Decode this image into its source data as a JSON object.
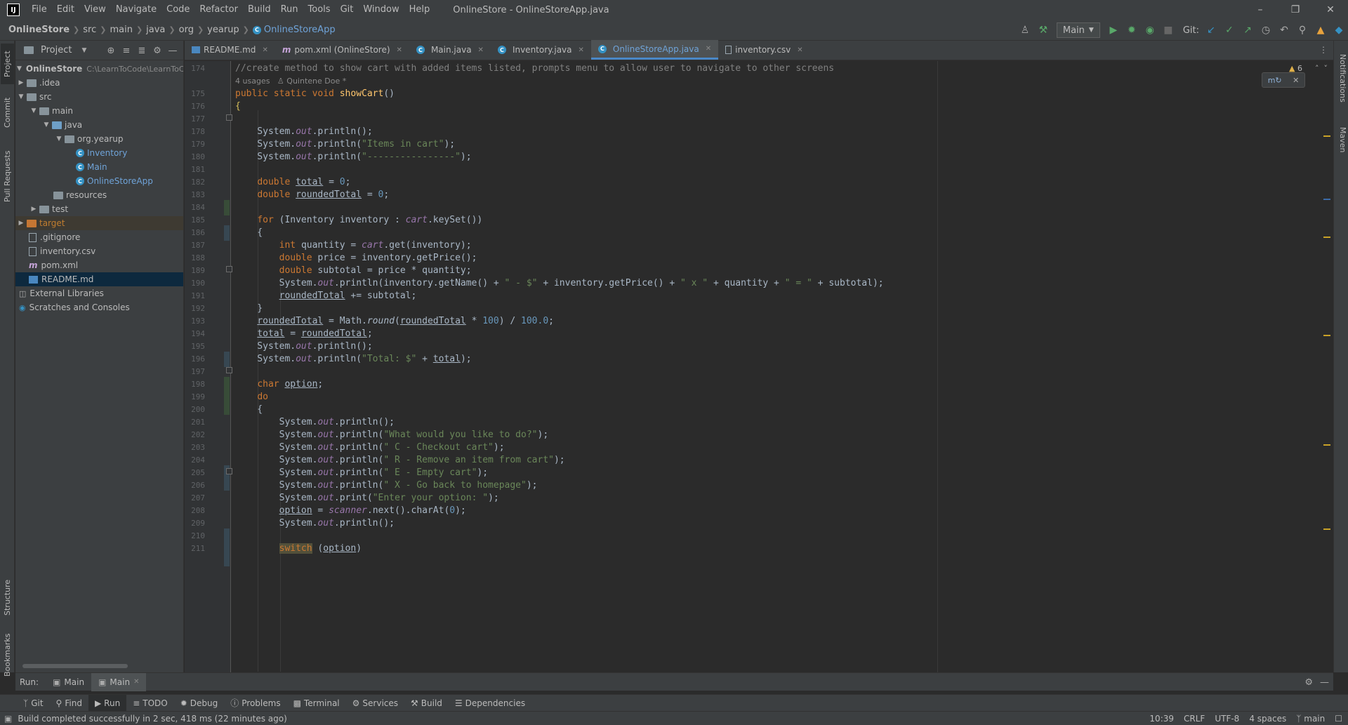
{
  "titlebar": {
    "menu": [
      "File",
      "Edit",
      "View",
      "Navigate",
      "Code",
      "Refactor",
      "Build",
      "Run",
      "Tools",
      "Git",
      "Window",
      "Help"
    ],
    "window_title": "OnlineStore - OnlineStoreApp.java",
    "logo_text": "IJ"
  },
  "breadcrumb": [
    "OnlineStore",
    "src",
    "main",
    "java",
    "org",
    "yearup",
    "OnlineStoreApp"
  ],
  "toolbar": {
    "run_config": "Main",
    "git_label": "Git:"
  },
  "left_stripe": [
    "Project",
    "Commit",
    "Pull Requests",
    "Structure",
    "Bookmarks"
  ],
  "right_stripe": [
    "Notifications",
    "Maven"
  ],
  "project_panel": {
    "title": "Project",
    "root_name": "OnlineStore",
    "root_path": "C:\\LearnToCode\\LearnToC",
    "items": [
      ".idea",
      "src",
      "main",
      "java",
      "org.yearup",
      "Inventory",
      "Main",
      "OnlineStoreApp",
      "resources",
      "test",
      "target",
      ".gitignore",
      "inventory.csv",
      "pom.xml",
      "README.md",
      "External Libraries",
      "Scratches and Consoles"
    ]
  },
  "tabs": [
    "README.md",
    "pom.xml (OnlineStore)",
    "Main.java",
    "Inventory.java",
    "OnlineStoreApp.java",
    "inventory.csv"
  ],
  "editor": {
    "line_numbers": [
      "174",
      "175",
      "176",
      "177",
      "178",
      "179",
      "180",
      "181",
      "182",
      "183",
      "184",
      "185",
      "186",
      "187",
      "188",
      "189",
      "190",
      "191",
      "192",
      "193",
      "194",
      "195",
      "196",
      "197",
      "198",
      "199",
      "200",
      "201",
      "202",
      "203",
      "204",
      "205",
      "206",
      "207",
      "208",
      "209",
      "210",
      "211"
    ],
    "comment": "//create method to show cart with added items listed, prompts menu to allow user to navigate to other screens",
    "usages_hint": "4 usages",
    "author_hint": "Quintene Doe *",
    "warning_count": "6",
    "strings": {
      "items_in_cart": "\"Items in cart\"",
      "dashes": "\"----------------\"",
      "dash_dollar": "\" - $\"",
      "times": "\" x \"",
      "equals": "\" = \"",
      "total": "\"Total: $\"",
      "prompt": "\"What would you like to do?\"",
      "opt_c": "\" C - Checkout cart\"",
      "opt_r": "\" R - Remove an item from cart\"",
      "opt_e": "\" E - Empty cart\"",
      "opt_x": "\" X - Go back to homepage\"",
      "enter": "\"Enter your option: \""
    },
    "numbers": {
      "zero": "0",
      "hundred": "100",
      "hundred_f": "100.0"
    }
  },
  "run_bar": {
    "label": "Run:",
    "tabs": [
      "Main",
      "Main"
    ]
  },
  "bottom_tools": [
    "Git",
    "Find",
    "Run",
    "TODO",
    "Debug",
    "Problems",
    "Terminal",
    "Services",
    "Build",
    "Dependencies"
  ],
  "status": {
    "message": "Build completed successfully in 2 sec, 418 ms (22 minutes ago)",
    "position": "10:39",
    "line_sep": "CRLF",
    "encoding": "UTF-8",
    "indent": "4 spaces",
    "branch": "main"
  },
  "colors": {
    "keyword": "#cc7832",
    "string": "#6a8759",
    "number": "#6897bb",
    "method": "#ffc66d",
    "static_field": "#9876aa"
  }
}
